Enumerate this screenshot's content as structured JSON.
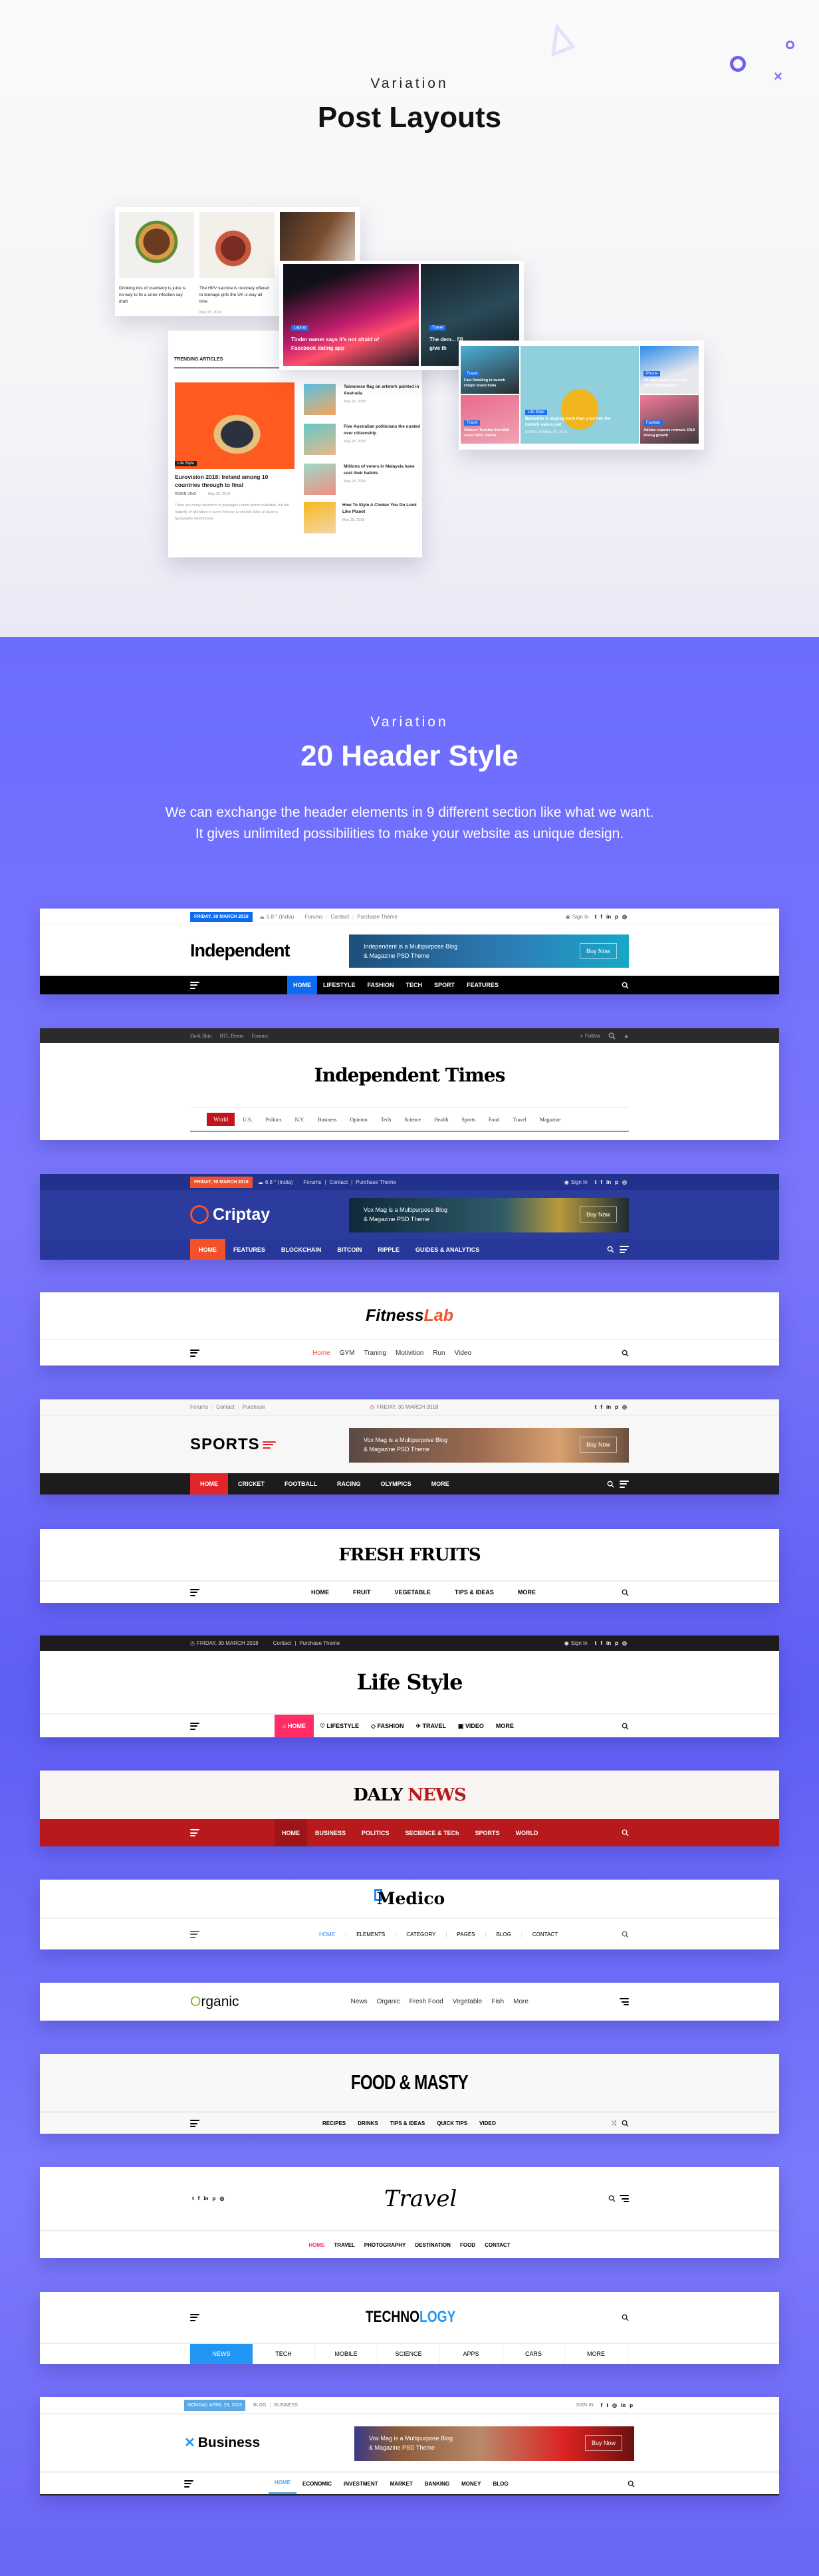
{
  "post_layouts": {
    "eyebrow": "Variation",
    "title": "Post Layouts",
    "card_food": {
      "items": [
        {
          "title": "Drinking lots of cranberry is juice is no way to fix a urine infection say draft"
        },
        {
          "title": "The HPV vaccine is routinely offered to teenage girls the UK is way all time",
          "date": "May 25, 2018"
        }
      ]
    },
    "card_slider": {
      "items": [
        {
          "tag": "Laptop",
          "title": "Tinder owner says it's not afraid of Facebook dating app"
        },
        {
          "tag": "Travel",
          "title": "The dem... I'll give th"
        }
      ]
    },
    "card_trending": {
      "heading": "TRENDING ARTICLES",
      "main": {
        "tag": "Life Style",
        "title": "Eurovision 2018: Ireland among 10 countries through to final",
        "author": "ROBIN VINO",
        "date": "May 25, 2018",
        "excerpt": "There are many variations of passages Lorem Ipsum available, but the majority of alteration in some form by a injected dolor sit dummy typography randomised."
      },
      "list": [
        {
          "title": "Taiwanese flag on artwork painted in Australia",
          "date": "May 25, 2018"
        },
        {
          "title": "Five Australian politicians the ousted over citizenship",
          "date": "May 25, 2018"
        },
        {
          "title": "Millions of voters in Malaysia have cast their ballots",
          "date": "May 25, 2018"
        },
        {
          "title": "How To Style A Choker You Do Look Like Planet",
          "date": "May 25, 2018"
        }
      ]
    },
    "card_grid": {
      "items": [
        {
          "tag": "Travel",
          "title": "Fast Retailing to launch Uniqlo brand India"
        },
        {
          "tag": "Travel",
          "title": "Chinese Toshiba firm Mall seeks $500 million"
        },
        {
          "tag": "Life Style",
          "title": "Bestseller is dipping more than a toe into the biotech waters just",
          "author": "ROBIN VINO",
          "date": "May 25, 2018"
        },
        {
          "tag": "Phone",
          "title": "Ad sales surge at Google parent the Alphabet"
        },
        {
          "tag": "Fashion",
          "title": "Adidas expects normals 2018 strong growth"
        }
      ]
    }
  },
  "header_styles": {
    "eyebrow": "Variation",
    "title": "20 Header Style",
    "description_line1": "We can exchange the header elements in 9 different section like what we want.",
    "description_line2": "It gives unlimited possibilities to make your website as unique design."
  },
  "colors": {
    "accent_purple": "#6c6cff",
    "independent_blue": "#0b6cf2",
    "criptay_navy": "#2b3c9e",
    "criptay_orange": "#f2512b",
    "fitness_orange": "#f2512b",
    "sports_red": "#e0262b",
    "lifestyle_pink": "#ff2d66",
    "dalynews_red": "#b8191c",
    "medico_blue": "#2c88f0",
    "organic_green": "#7bbf1e",
    "technology_blue": "#2196f3"
  },
  "headers": [
    {
      "date": "FRIDAY, 30 MARCH 2018",
      "weather": "6.8 ° (India)",
      "links": [
        "Forums",
        "Contact",
        "Purchase Theme"
      ],
      "sign_in": "Sign In",
      "logo": "Independent",
      "ad_line1": "Independent is a Multipurpose Blog",
      "ad_line2": "& Magazine PSD Theme",
      "ad_button": "Buy Now",
      "nav": [
        "HOME",
        "LIFESTYLE",
        "FASHION",
        "TECH",
        "SPORT",
        "FEATURES"
      ],
      "active": "HOME"
    },
    {
      "links": [
        "Dark Skin",
        "RTL Demo",
        "Forums"
      ],
      "follow": "Follow",
      "logo": "Independent Times",
      "nav": [
        "World",
        "U.S.",
        "Politics",
        "N.Y.",
        "Business",
        "Opinion",
        "Tech",
        "Science",
        "Health",
        "Sports",
        "Food",
        "Travel",
        "Magazine"
      ],
      "active": "World"
    },
    {
      "date": "FRIDAY, 30 MARCH 2018",
      "weather": "6.8 ° (India)",
      "links": [
        "Forums",
        "Contact",
        "Purchase Theme"
      ],
      "sign_in": "Sign In",
      "logo": "Criptay",
      "ad_line1": "Vox Mag is a Multipurpose Blog",
      "ad_line2": "& Magazine PSD Theme",
      "ad_button": "Buy Now",
      "nav": [
        "HOME",
        "FEATURES",
        "BLOCKCHAIN",
        "BITCOIN",
        "RIPPLE",
        "GUIDES & ANALYTICS"
      ],
      "active": "HOME"
    },
    {
      "logo_part1": "Fitness",
      "logo_part2": "Lab",
      "nav": [
        "Home",
        "GYM",
        "Traning",
        "Motivition",
        "Run",
        "Video"
      ],
      "active": "Home"
    },
    {
      "links": [
        "Forums",
        "Contact",
        "Purchase"
      ],
      "date": "FRIDAY, 30 MARCH 2018",
      "logo": "SPORTS",
      "ad_line1": "Vox Mag is a Multipurpose Blog",
      "ad_line2": "& Magazine PSD Theme",
      "ad_button": "Buy Now",
      "nav": [
        "HOME",
        "CRICKET",
        "FOOTBALL",
        "RACING",
        "OLYMPICS",
        "MORE"
      ],
      "active": "HOME"
    },
    {
      "logo": "FRESH FRUITS",
      "nav": [
        "HOME",
        "FRUIT",
        "VEGETABLE",
        "TIPS & IDEAS",
        "MORE"
      ]
    },
    {
      "date": "FRIDAY, 30 MARCH 2018",
      "links": [
        "Contact",
        "Purchase Theme"
      ],
      "sign_in": "Sign In",
      "logo": "Life Style",
      "nav": [
        "HOME",
        "LIFESTYLE",
        "FASHION",
        "TRAVEL",
        "VIDEO",
        "MORE"
      ],
      "active": "HOME"
    },
    {
      "logo_part1": "DALY",
      "logo_part2": "NEWS",
      "nav": [
        "HOME",
        "BUSINESS",
        "POLITICS",
        "SECIENCE & TECh",
        "SPORTS",
        "WORLD"
      ],
      "active": "HOME"
    },
    {
      "logo": "Medico",
      "nav": [
        "HOME",
        "ELEMENTS",
        "CATEGORY",
        "PAGES",
        "BLOG",
        "CONTACT"
      ],
      "active": "HOME"
    },
    {
      "logo_part1": "O",
      "logo_part2": "rganic",
      "nav": [
        "News",
        "Organic",
        "Fresh Food",
        "Vegetable",
        "Fish",
        "More"
      ]
    },
    {
      "logo": "FOOD & MASTY",
      "nav": [
        "RECIPES",
        "DRINKS",
        "TIPS & IDEAS",
        "QUICK TIPS",
        "VIDEO"
      ]
    },
    {
      "logo": "Travel",
      "nav": [
        "HOME",
        "TRAVEL",
        "PHOTOGRAPHY",
        "DESTINATION",
        "FOOD",
        "CONTACT"
      ],
      "active": "HOME"
    },
    {
      "logo_part1": "TECHNO",
      "logo_part2": "LOGY",
      "nav": [
        "NEWS",
        "TECH",
        "MOBILE",
        "SCIENCE",
        "APPS",
        "CARS",
        "MORE"
      ],
      "active": "NEWS"
    },
    {
      "date": "MONDAY, APRIL 29, 2019",
      "links": [
        "BLOG",
        "BUSINESS"
      ],
      "sign_in": "SIGN IN",
      "logo": "Business",
      "ad_line1": "Vox Mag is a Multipurpose Blog",
      "ad_line2": "& Magazine PSD Theme",
      "ad_button": "Buy Now",
      "nav": [
        "HOME",
        "ECONOMIC",
        "INVESTMENT",
        "MARKET",
        "BANKING",
        "MONEY",
        "BLOG"
      ],
      "active": "HOME"
    }
  ]
}
